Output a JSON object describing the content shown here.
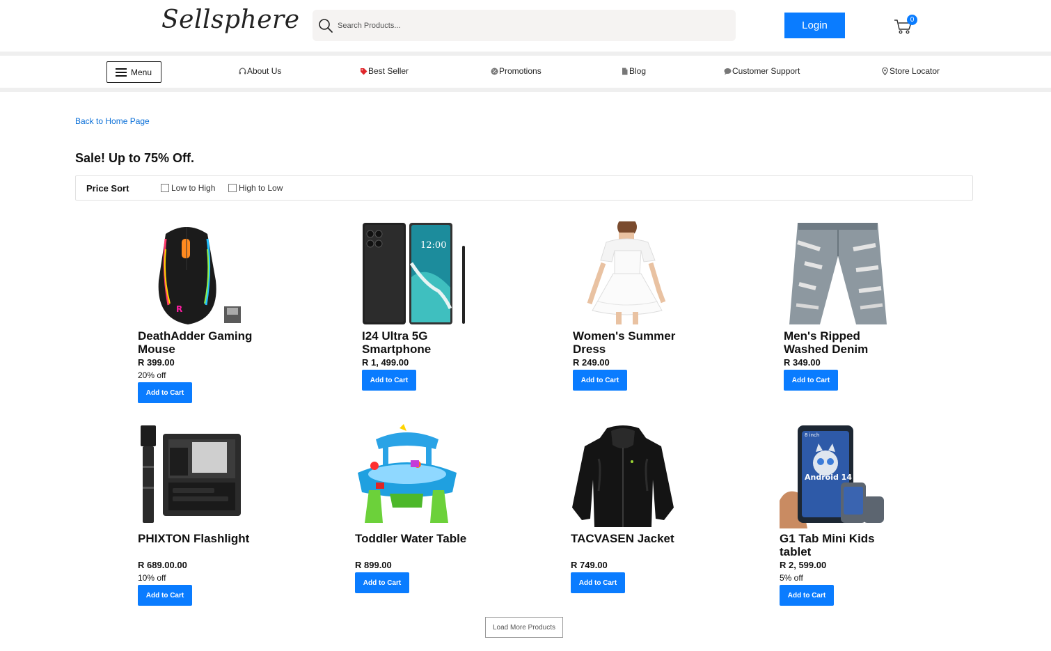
{
  "header": {
    "logo_text": "Sellsphere",
    "search_placeholder": "Search Products...",
    "login_label": "Login",
    "cart_count": "0"
  },
  "nav": {
    "menu_label": "Menu",
    "items": [
      {
        "label": "About Us",
        "icon": "headset-icon"
      },
      {
        "label": "Best Seller",
        "icon": "tag-icon"
      },
      {
        "label": "Promotions",
        "icon": "percent-icon"
      },
      {
        "label": "Blog",
        "icon": "document-icon"
      },
      {
        "label": "Customer Support",
        "icon": "chat-icon"
      },
      {
        "label": "Store Locator",
        "icon": "map-pin-icon"
      }
    ]
  },
  "main": {
    "back_link": "Back to Home Page",
    "title": "Sale! Up to 75% Off.",
    "sort": {
      "label": "Price Sort",
      "options": [
        "Low to High",
        "High to Low"
      ]
    },
    "add_to_cart_label": "Add to Cart",
    "load_more_label": "Load More Products"
  },
  "products": [
    {
      "name": "DeathAdder Gaming Mouse",
      "price": "R 399.00",
      "discount": "20% off",
      "image": "gaming-mouse-image"
    },
    {
      "name": "I24 Ultra 5G Smartphone",
      "price": "R 1, 499.00",
      "discount": "",
      "image": "smartphone-image"
    },
    {
      "name": "Women's Summer Dress",
      "price": "R 249.00",
      "discount": "",
      "image": "dress-image"
    },
    {
      "name": "Men's Ripped Washed Denim",
      "price": "R 349.00",
      "discount": "",
      "image": "denim-image"
    },
    {
      "name": "PHIXTON Flashlight",
      "price": "R 689.00.00",
      "discount": "10% off",
      "image": "flashlight-image"
    },
    {
      "name": "Toddler Water Table",
      "price": "R 899.00",
      "discount": "",
      "image": "water-table-image"
    },
    {
      "name": "TACVASEN Jacket",
      "price": "R 749.00",
      "discount": "",
      "image": "jacket-image"
    },
    {
      "name": "G1 Tab Mini Kids tablet",
      "price": "R 2, 599.00",
      "discount": "5% off",
      "image": "tablet-image"
    }
  ],
  "colors": {
    "accent": "#0a7cff",
    "link": "#0a6fd8"
  }
}
